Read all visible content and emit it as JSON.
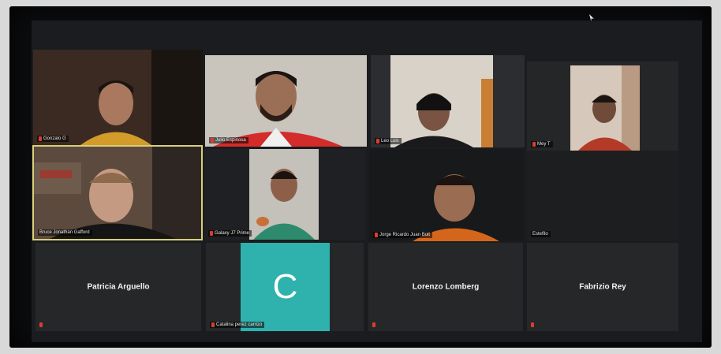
{
  "meeting": {
    "participants": [
      {
        "name": "Gonzalo G",
        "type": "video"
      },
      {
        "name": "Julio Espinosa",
        "type": "video"
      },
      {
        "name": "Leo Luis",
        "type": "video"
      },
      {
        "name": "Mey T",
        "type": "video"
      },
      {
        "name": "Bruce Jonathan Gafford",
        "type": "video",
        "active": true
      },
      {
        "name": "Galaxy J7 Prime",
        "type": "video"
      },
      {
        "name": "Jorge Ricardo Juan Bolt",
        "type": "video"
      },
      {
        "name": "Estefilo",
        "type": "video-off"
      },
      {
        "name": "Patricia Arguello",
        "type": "name-card"
      },
      {
        "name": "Catalina perez carrizo",
        "type": "avatar",
        "initial": "C"
      },
      {
        "name": "Lorenzo Lomberg",
        "type": "name-card"
      },
      {
        "name": "Fabrizio Rey",
        "type": "name-card"
      }
    ],
    "avatar_color": "#2fb1ad",
    "mic_muted_color": "#e03a2f",
    "active_speaker_border": "#d8cf7a"
  }
}
